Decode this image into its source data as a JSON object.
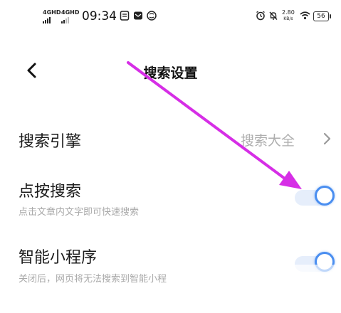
{
  "status_bar": {
    "net1": "4GHD",
    "net2": "4GHD",
    "time": "09:34",
    "speed_value": "2.80",
    "speed_unit": "KB/s",
    "battery": "56"
  },
  "header": {
    "title": "搜索设置"
  },
  "settings": {
    "engine": {
      "label": "搜索引擎",
      "value": "搜索大全"
    },
    "tap_search": {
      "label": "点按搜索",
      "desc": "点击文章内文字即可快速搜索",
      "enabled": true
    },
    "mini_program": {
      "label": "智能小程序",
      "desc": "关闭后，网页将无法搜索到智能小程",
      "enabled": true
    }
  },
  "colors": {
    "accent": "#4a8ef0",
    "annotation_arrow": "#d62ee6"
  }
}
